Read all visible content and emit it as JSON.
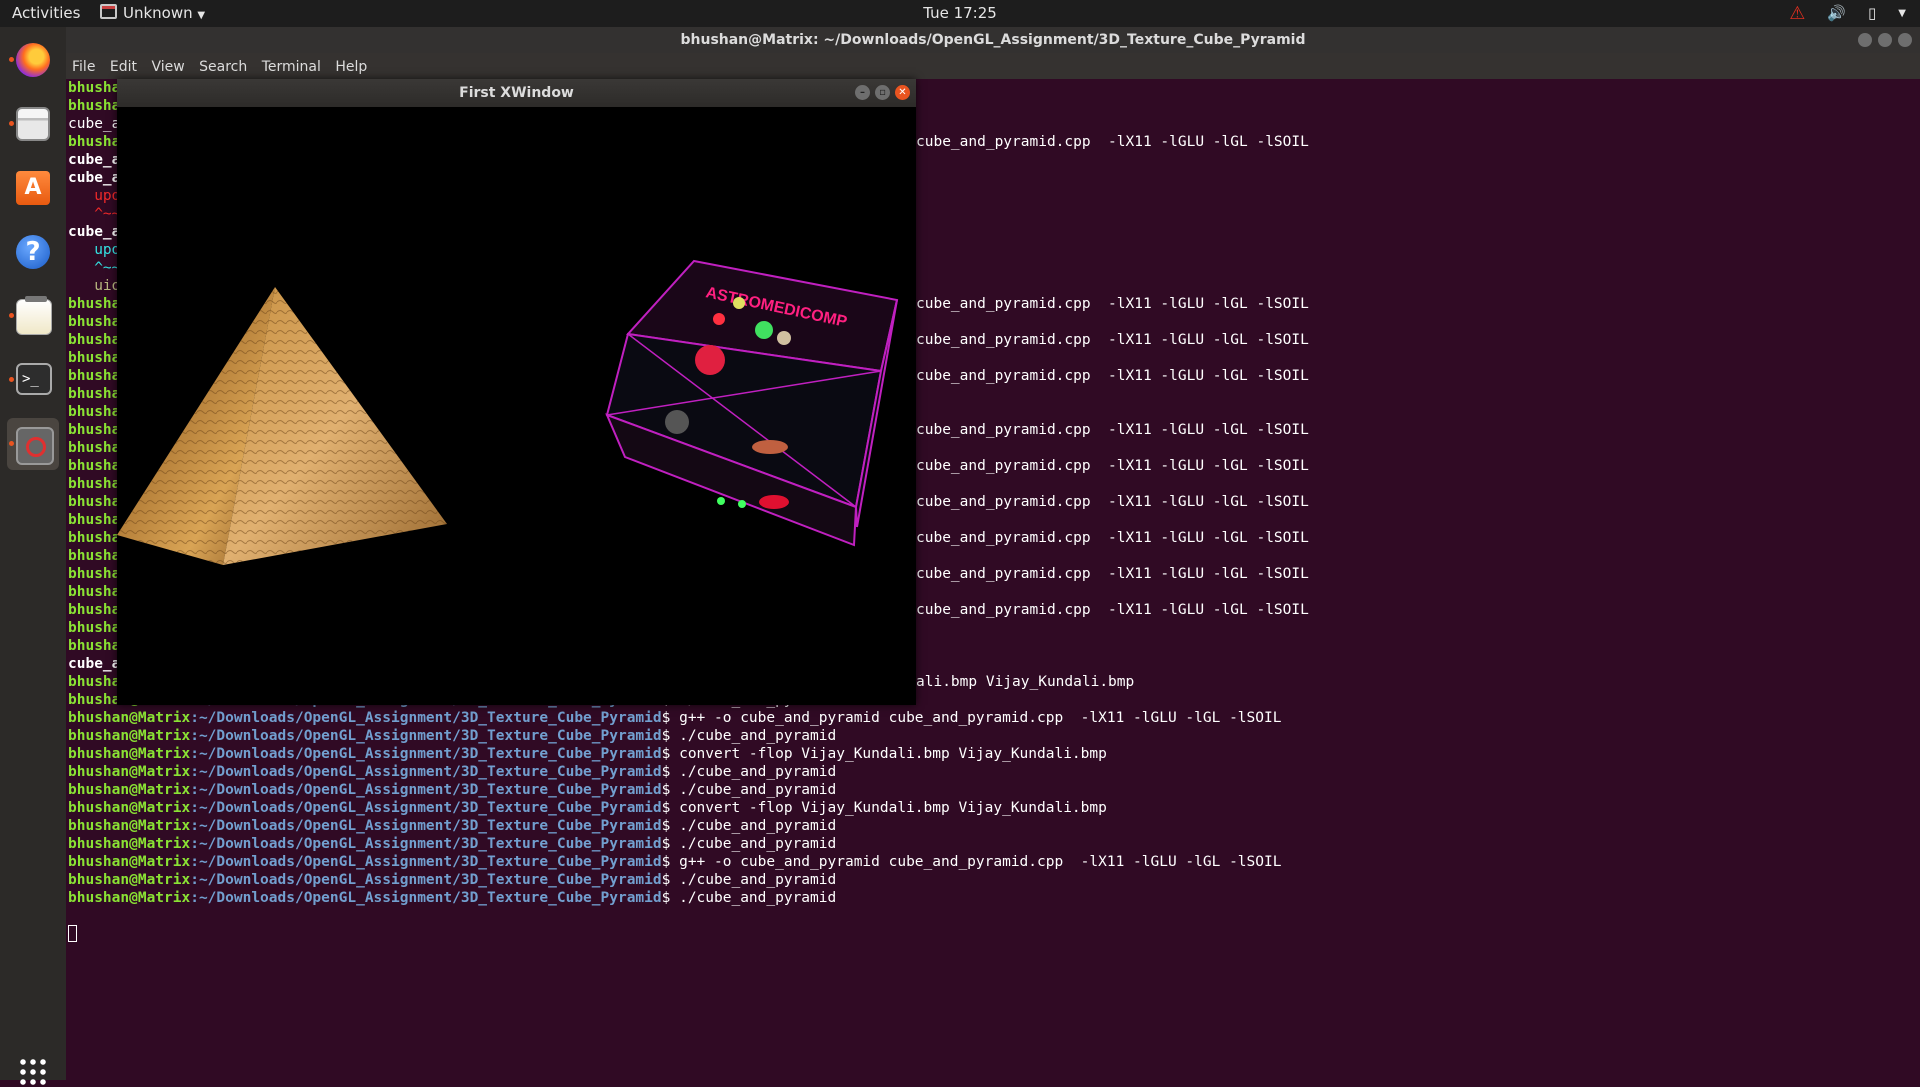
{
  "topbar": {
    "activities": "Activities",
    "app_menu": "Unknown",
    "clock": "Tue 17:25"
  },
  "terminal": {
    "title": "bhushan@Matrix: ~/Downloads/OpenGL_Assignment/3D_Texture_Cube_Pyramid",
    "menu": [
      "File",
      "Edit",
      "View",
      "Search",
      "Terminal",
      "Help"
    ],
    "prompt_user": "bhushan@Matrix",
    "prompt_path": ":~/Downloads/OpenGL_Assignment/3D_Texture_Cube_Pyramid",
    "prompt_suffix": "$ ",
    "left_fragments": [
      {
        "text": "bhusha",
        "kind": "prompt"
      },
      {
        "text": "bhusha",
        "kind": "prompt"
      },
      {
        "text": "cube_a",
        "kind": "plain"
      },
      {
        "text": "bhusha",
        "kind": "prompt"
      },
      {
        "text": "cube_a",
        "kind": "bold"
      },
      {
        "text": "cube_a",
        "kind": "bold"
      },
      {
        "text": "   upd",
        "kind": "red"
      },
      {
        "text": "   ^~~",
        "kind": "red"
      },
      {
        "text": "cube_a",
        "kind": "bold"
      },
      {
        "text": "   upd",
        "kind": "cyan"
      },
      {
        "text": "   ^~~",
        "kind": "cyan"
      },
      {
        "text": "   uio",
        "kind": "olive"
      },
      {
        "text": "bhusha",
        "kind": "prompt"
      },
      {
        "text": "bhusha",
        "kind": "prompt"
      },
      {
        "text": "bhusha",
        "kind": "prompt"
      },
      {
        "text": "bhusha",
        "kind": "prompt"
      },
      {
        "text": "bhusha",
        "kind": "prompt"
      },
      {
        "text": "bhusha",
        "kind": "prompt"
      },
      {
        "text": "bhusha",
        "kind": "prompt"
      },
      {
        "text": "bhusha",
        "kind": "prompt"
      },
      {
        "text": "bhusha",
        "kind": "prompt"
      },
      {
        "text": "bhusha",
        "kind": "prompt"
      },
      {
        "text": "bhusha",
        "kind": "prompt"
      },
      {
        "text": "bhusha",
        "kind": "prompt"
      },
      {
        "text": "bhusha",
        "kind": "prompt"
      },
      {
        "text": "bhusha",
        "kind": "prompt"
      },
      {
        "text": "bhusha",
        "kind": "prompt"
      },
      {
        "text": "bhusha",
        "kind": "prompt"
      },
      {
        "text": "bhusha",
        "kind": "prompt"
      },
      {
        "text": "bhusha",
        "kind": "prompt"
      },
      {
        "text": "bhusha",
        "kind": "prompt"
      },
      {
        "text": "bhusha",
        "kind": "prompt"
      },
      {
        "text": "cube_a",
        "kind": "bold"
      },
      {
        "text": "bhusha",
        "kind": "prompt"
      }
    ],
    "right_fragments": [
      {
        "line": 3,
        "text": "cube_and_pyramid.cpp  -lX11 -lGLU -lGL -lSOIL"
      },
      {
        "line": 12,
        "text": "cube_and_pyramid.cpp  -lX11 -lGLU -lGL -lSOIL"
      },
      {
        "line": 14,
        "text": "cube_and_pyramid.cpp  -lX11 -lGLU -lGL -lSOIL"
      },
      {
        "line": 16,
        "text": "cube_and_pyramid.cpp  -lX11 -lGLU -lGL -lSOIL"
      },
      {
        "line": 19,
        "text": "cube_and_pyramid.cpp  -lX11 -lGLU -lGL -lSOIL"
      },
      {
        "line": 21,
        "text": "cube_and_pyramid.cpp  -lX11 -lGLU -lGL -lSOIL"
      },
      {
        "line": 23,
        "text": "cube_and_pyramid.cpp  -lX11 -lGLU -lGL -lSOIL"
      },
      {
        "line": 25,
        "text": "cube_and_pyramid.cpp  -lX11 -lGLU -lGL -lSOIL"
      },
      {
        "line": 27,
        "text": "cube_and_pyramid.cpp  -lX11 -lGLU -lGL -lSOIL"
      },
      {
        "line": 29,
        "text": "cube_and_pyramid.cpp  -lX11 -lGLU -lGL -lSOIL"
      },
      {
        "line": 33,
        "text": "ali.bmp Vijay_Kundali.bmp"
      }
    ],
    "full_lines": [
      "./cube_and_pyramid",
      "g++ -o cube_and_pyramid cube_and_pyramid.cpp  -lX11 -lGLU -lGL -lSOIL",
      "./cube_and_pyramid",
      "convert -flop Vijay_Kundali.bmp Vijay_Kundali.bmp",
      "./cube_and_pyramid",
      "./cube_and_pyramid",
      "convert -flop Vijay_Kundali.bmp Vijay_Kundali.bmp",
      "./cube_and_pyramid",
      "./cube_and_pyramid",
      "g++ -o cube_and_pyramid cube_and_pyramid.cpp  -lX11 -lGLU -lGL -lSOIL",
      "./cube_and_pyramid",
      "./cube_and_pyramid"
    ]
  },
  "xwindow": {
    "title": "First XWindow",
    "cube_texture_text": "ASTROMEDICOMP"
  },
  "colors": {
    "terminal_bg": "#300a24",
    "prompt_user": "#8ae234",
    "prompt_path": "#729fcf",
    "accent": "#e95420"
  }
}
